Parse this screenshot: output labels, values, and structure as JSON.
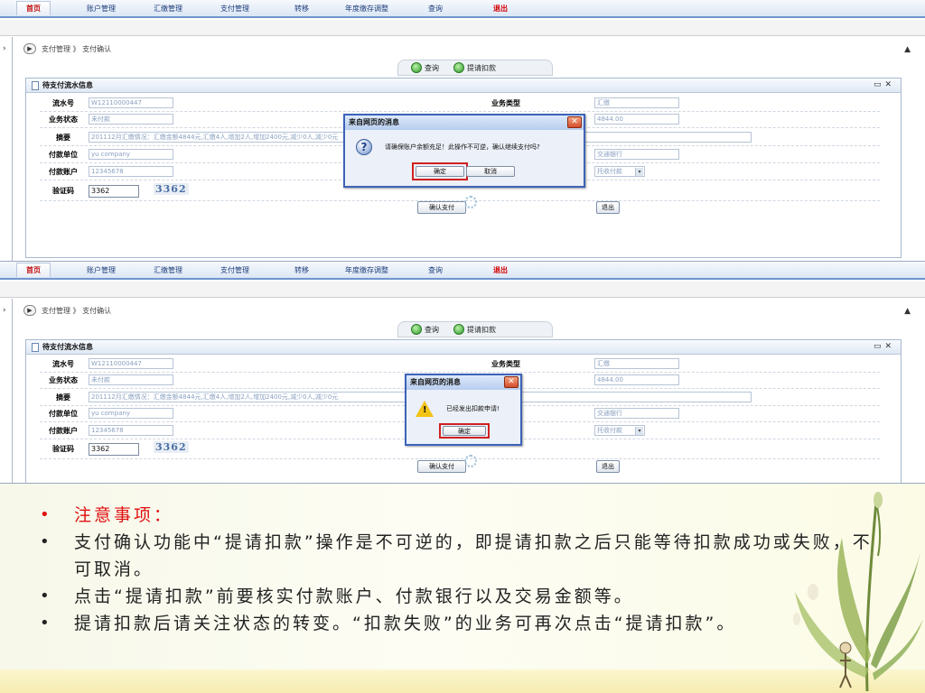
{
  "nav": [
    "首页",
    "账户管理",
    "汇缴管理",
    "支付管理",
    "转移",
    "年度缴存调整",
    "查询",
    "退出"
  ],
  "breadcrumb": "支付管理 》 支付确认",
  "toolbar": {
    "query": "查询",
    "submit_deduct": "提请扣款"
  },
  "panel_title": "待支付流水信息",
  "form": {
    "serial_label": "流水号",
    "serial_value": "W12110000447",
    "biztype_label": "业务类型",
    "biztype_value": "汇缴",
    "status_label": "业务状态",
    "status_value": "未付款",
    "amount_value": "4844.00",
    "summary_label": "摘要",
    "summary_value": "201112月汇缴情况：汇缴金额4844元,汇缴4人,增加2人,增加2400元,减少0人,减少0元",
    "payer_label": "付款单位",
    "payer_value": "yu company",
    "bank_value": "交通银行",
    "account_label": "付款账户",
    "account_value": "12345678",
    "paymethod_value": "托收付款",
    "captcha_label": "验证码",
    "captcha_input": "3362",
    "captcha_image": "3362",
    "confirm_pay": "确认支付",
    "exit": "退出"
  },
  "dialog1": {
    "title": "来自网页的消息",
    "message": "请确保账户余额充足！此操作不可逆，确认继续支付吗?",
    "ok": "确定",
    "cancel": "取消"
  },
  "dialog2": {
    "title": "来自网页的消息",
    "message": "已经发出扣款申请!",
    "ok": "确定"
  },
  "notes": [
    "注意事项：",
    "支付确认功能中“提请扣款”操作是不可逆的，即提请扣款之后只能等待扣款成功或失败，不可取消。",
    "点击“提请扣款”前要核实付款账户、付款银行以及交易金额等。",
    "提请扣款后请关注状态的转变。“扣款失败”的业务可再次点击“提请扣款”。"
  ],
  "colors": {
    "accent": "#3c63b8",
    "note_highlight": "#e01010",
    "exit_link": "#d40000"
  }
}
